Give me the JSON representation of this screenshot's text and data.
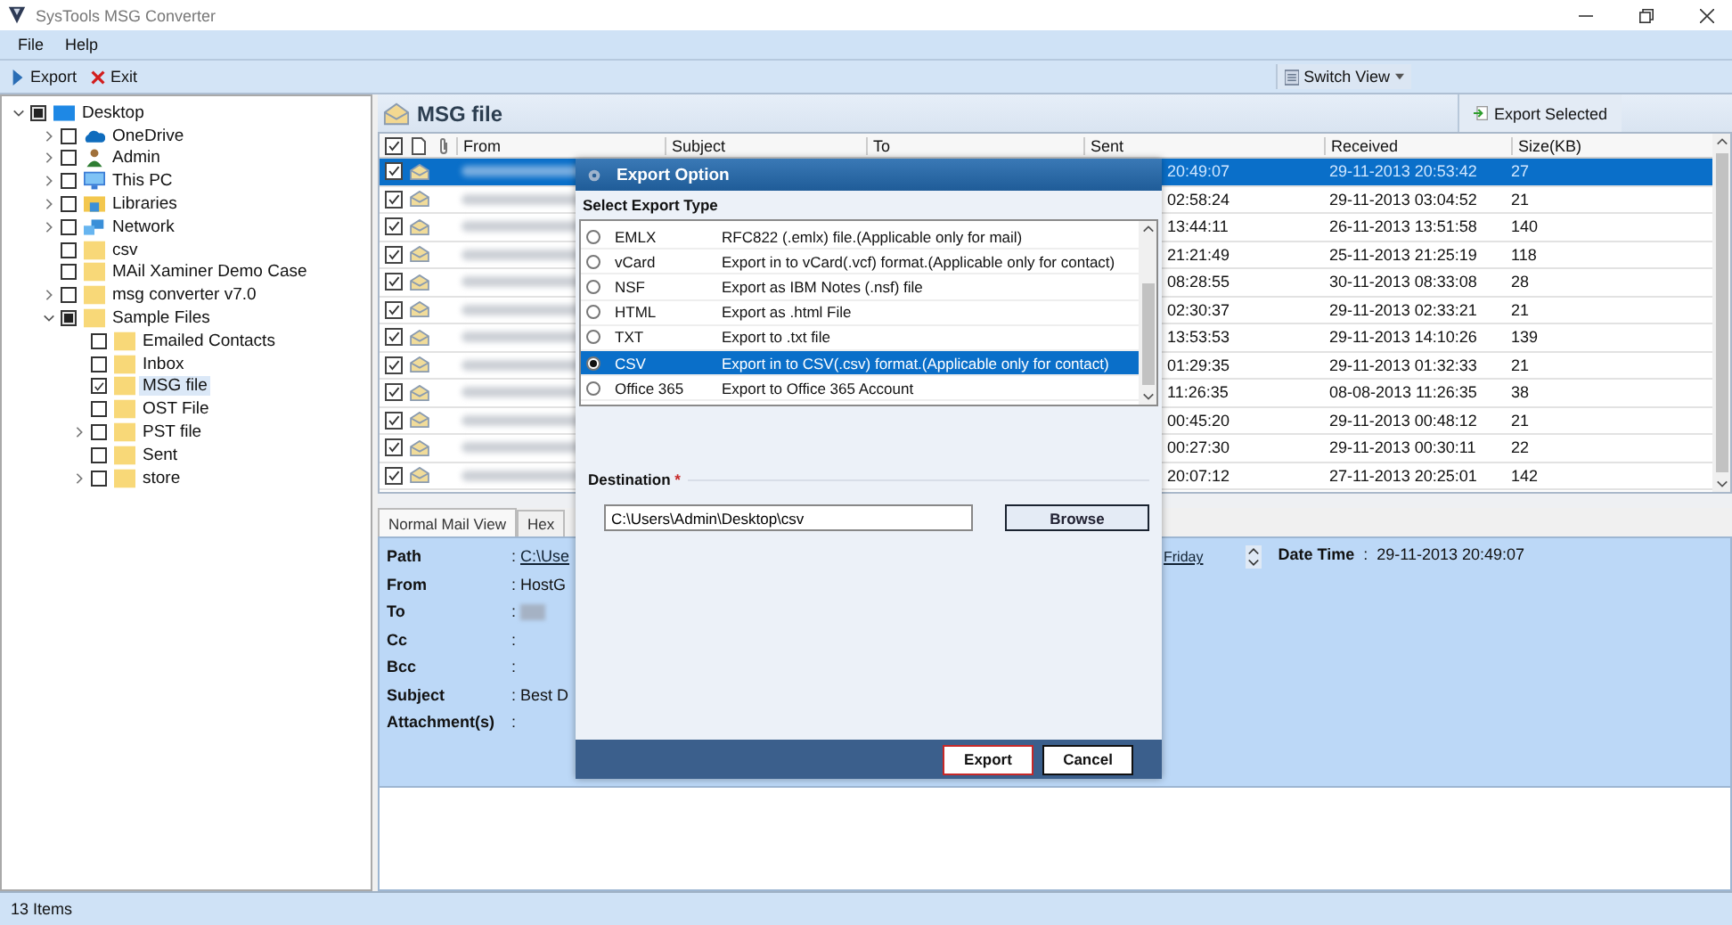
{
  "window": {
    "title": "SysTools MSG Converter"
  },
  "menu": [
    "File",
    "Help"
  ],
  "toolbar": [
    {
      "label": "Export",
      "kind": "play"
    },
    {
      "label": "Exit",
      "kind": "close"
    }
  ],
  "switch_view": "Switch View",
  "tree": [
    {
      "label": "Desktop",
      "kind": "desktop",
      "checked": false,
      "partial": true,
      "expanded": true,
      "selected": false,
      "children": [
        {
          "label": "OneDrive",
          "kind": "cloud",
          "checked": false,
          "partial": false,
          "expanded": false,
          "selected": false
        },
        {
          "label": "Admin",
          "kind": "user",
          "checked": false,
          "partial": false,
          "expanded": false,
          "selected": false
        },
        {
          "label": "This PC",
          "kind": "computer",
          "checked": false,
          "partial": false,
          "expanded": false,
          "selected": false
        },
        {
          "label": "Libraries",
          "kind": "library",
          "checked": false,
          "partial": false,
          "expanded": false,
          "selected": false
        },
        {
          "label": "Network",
          "kind": "network",
          "checked": false,
          "partial": false,
          "expanded": false,
          "selected": false
        },
        {
          "label": "csv",
          "kind": "folder",
          "checked": false,
          "partial": false,
          "selected": false
        },
        {
          "label": "MAil Xaminer Demo Case",
          "kind": "folder",
          "checked": false,
          "partial": false,
          "selected": false
        },
        {
          "label": "msg converter v7.0",
          "kind": "folder",
          "checked": false,
          "partial": false,
          "expanded": false,
          "selected": false
        },
        {
          "label": "Sample Files",
          "kind": "folder",
          "checked": false,
          "partial": true,
          "expanded": true,
          "selected": false,
          "children": [
            {
              "label": "Emailed Contacts",
              "kind": "folder",
              "checked": false,
              "partial": false,
              "selected": false
            },
            {
              "label": "Inbox",
              "kind": "folder",
              "checked": false,
              "partial": false,
              "selected": false
            },
            {
              "label": "MSG file",
              "kind": "folder",
              "checked": true,
              "partial": false,
              "selected": true
            },
            {
              "label": "OST File",
              "kind": "folder",
              "checked": false,
              "partial": false,
              "selected": false
            },
            {
              "label": "PST file",
              "kind": "folder",
              "checked": false,
              "partial": false,
              "expanded": false,
              "selected": false
            },
            {
              "label": "Sent",
              "kind": "folder",
              "checked": false,
              "partial": false,
              "selected": false
            },
            {
              "label": "store",
              "kind": "folder",
              "checked": false,
              "partial": false,
              "expanded": false,
              "selected": false
            }
          ]
        }
      ]
    }
  ],
  "folder_title": "MSG file",
  "export_selected": "Export Selected",
  "table": {
    "all_checked": true,
    "columns": [
      "From",
      "Subject",
      "To",
      "Sent",
      "Received",
      "Size(KB)"
    ],
    "rows": [
      {
        "checked": true,
        "selected": true,
        "sent": "20:49:07",
        "received": "29-11-2013 20:53:42",
        "size": "27"
      },
      {
        "checked": true,
        "selected": false,
        "sent": "02:58:24",
        "received": "29-11-2013 03:04:52",
        "size": "21"
      },
      {
        "checked": true,
        "selected": false,
        "sent": "13:44:11",
        "received": "26-11-2013 13:51:58",
        "size": "140"
      },
      {
        "checked": true,
        "selected": false,
        "sent": "21:21:49",
        "received": "25-11-2013 21:25:19",
        "size": "118"
      },
      {
        "checked": true,
        "selected": false,
        "sent": "08:28:55",
        "received": "30-11-2013 08:33:08",
        "size": "28"
      },
      {
        "checked": true,
        "selected": false,
        "sent": "02:30:37",
        "received": "29-11-2013 02:33:21",
        "size": "21"
      },
      {
        "checked": true,
        "selected": false,
        "sent": "13:53:53",
        "received": "29-11-2013 14:10:26",
        "size": "139"
      },
      {
        "checked": true,
        "selected": false,
        "sent": "01:29:35",
        "received": "29-11-2013 01:32:33",
        "size": "21"
      },
      {
        "checked": true,
        "selected": false,
        "sent": "11:26:35",
        "received": "08-08-2013 11:26:35",
        "size": "38"
      },
      {
        "checked": true,
        "selected": false,
        "sent": "00:45:20",
        "received": "29-11-2013 00:48:12",
        "size": "21"
      },
      {
        "checked": true,
        "selected": false,
        "sent": "00:27:30",
        "received": "29-11-2013 00:30:11",
        "size": "22"
      },
      {
        "checked": true,
        "selected": false,
        "sent": "20:07:12",
        "received": "27-11-2013 20:25:01",
        "size": "142"
      }
    ]
  },
  "preview": {
    "tabs": [
      {
        "label": "Normal Mail View",
        "selected": true
      },
      {
        "label": "Hex",
        "selected": false
      }
    ],
    "fields": [
      {
        "label": "Path",
        "separator": ":",
        "value": "C:\\Use",
        "kind": "link"
      },
      {
        "label": "From",
        "separator": ":",
        "value": "HostG",
        "kind": "text"
      },
      {
        "label": "To",
        "separator": ":",
        "kind": "blurred"
      },
      {
        "label": "Cc",
        "separator": ":",
        "kind": "text"
      },
      {
        "label": "Bcc",
        "separator": ":",
        "kind": "text"
      },
      {
        "label": "Subject",
        "separator": ":",
        "value": "Best D",
        "kind": "text"
      },
      {
        "label": "Attachment(s)",
        "separator": ":",
        "kind": "text"
      }
    ],
    "link_right": "Friday",
    "date_label": "Date Time",
    "date_separator": ":",
    "date_value": "29-11-2013 20:49:07"
  },
  "dialog": {
    "title": "Export Option",
    "section": "Select Export Type",
    "options": [
      {
        "name": "EMLX",
        "description": "RFC822 (.emlx) file.(Applicable only for mail)",
        "selected": false
      },
      {
        "name": "vCard",
        "description": "Export in to vCard(.vcf) format.(Applicable only for contact)",
        "selected": false
      },
      {
        "name": "NSF",
        "description": "Export as IBM Notes (.nsf) file",
        "selected": false
      },
      {
        "name": "HTML",
        "description": "Export as .html File",
        "selected": false
      },
      {
        "name": "TXT",
        "description": "Export to .txt file",
        "selected": false
      },
      {
        "name": "CSV",
        "description": "Export in to CSV(.csv) format.(Applicable only for contact)",
        "selected": true
      },
      {
        "name": "Office 365",
        "description": "Export to Office 365 Account",
        "selected": false
      }
    ],
    "destination_label": "Destination",
    "required_mark": "*",
    "destination_value": "C:\\Users\\Admin\\Desktop\\csv",
    "browse": "Browse",
    "buttons": [
      {
        "label": "Export",
        "focused": true
      },
      {
        "label": "Cancel",
        "focused": false
      }
    ]
  },
  "status_bar": "13 Items"
}
